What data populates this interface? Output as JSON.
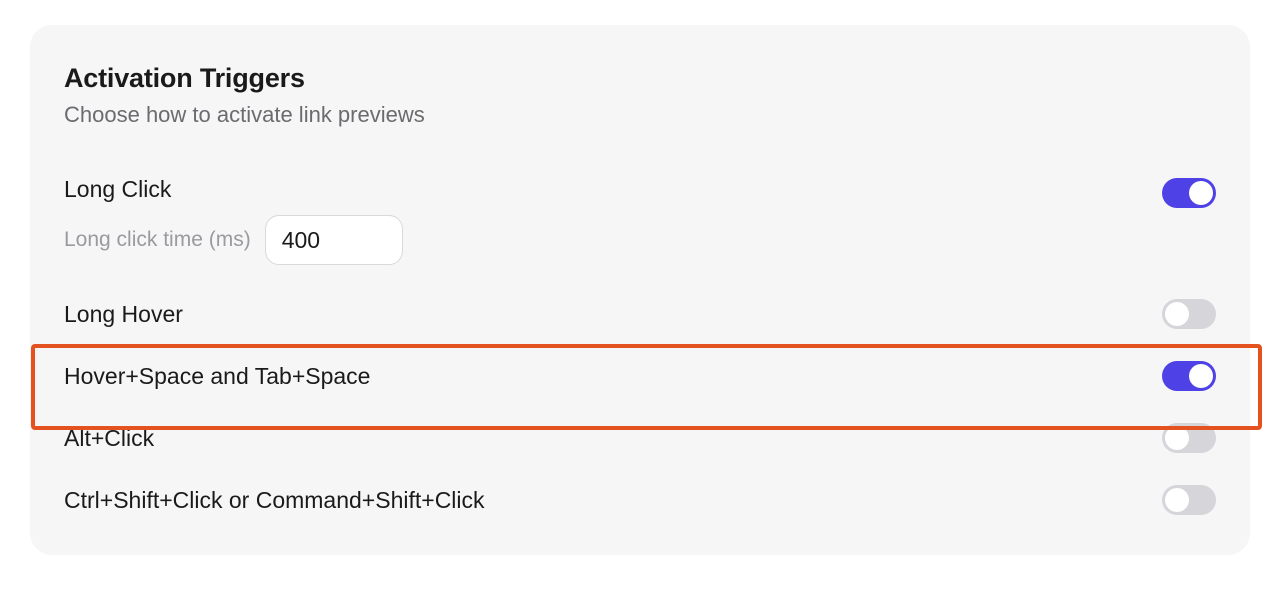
{
  "panel": {
    "title": "Activation Triggers",
    "subtitle": "Choose how to activate link previews"
  },
  "triggers": {
    "longClick": {
      "label": "Long Click",
      "enabled": true,
      "timeLabel": "Long click time (ms)",
      "timeValue": "400"
    },
    "longHover": {
      "label": "Long Hover",
      "enabled": false
    },
    "hoverSpace": {
      "label": "Hover+Space and Tab+Space",
      "enabled": true
    },
    "altClick": {
      "label": "Alt+Click",
      "enabled": false
    },
    "ctrlShiftClick": {
      "label": "Ctrl+Shift+Click or Command+Shift+Click",
      "enabled": false
    }
  },
  "colors": {
    "accent": "#4e42e6",
    "highlight": "#e4521f"
  }
}
